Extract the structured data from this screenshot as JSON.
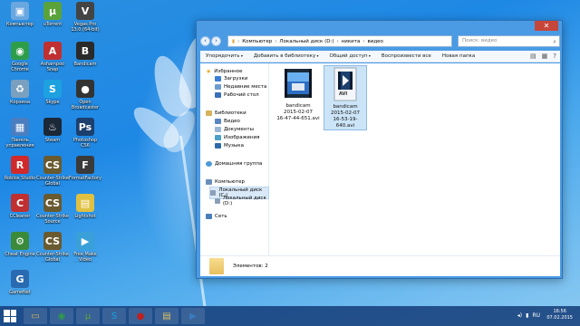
{
  "desktop": {
    "icons": [
      {
        "label": "Компьютер",
        "glyph": "▣",
        "color": "#6aa7e0"
      },
      {
        "label": "uTorrent",
        "glyph": "µ",
        "color": "#5aa33a"
      },
      {
        "label": "Vegas Pro 13.0 (64-bit)",
        "glyph": "V",
        "color": "#444"
      },
      {
        "label": "Google Chrome",
        "glyph": "◉",
        "color": "#2e9d4a"
      },
      {
        "label": "Ashampoo Snap",
        "glyph": "A",
        "color": "#c03030"
      },
      {
        "label": "Bandicam",
        "glyph": "B",
        "color": "#2a2a2a"
      },
      {
        "label": "Корзина",
        "glyph": "♻",
        "color": "#7aa0c0"
      },
      {
        "label": "Skype",
        "glyph": "S",
        "color": "#1da1e0"
      },
      {
        "label": "Open Broadcaster",
        "glyph": "●",
        "color": "#333"
      },
      {
        "label": "Панель управления",
        "glyph": "▦",
        "color": "#4a7ec0"
      },
      {
        "label": "Steam",
        "glyph": "♨",
        "color": "#1b2838"
      },
      {
        "label": "Photoshop CS6",
        "glyph": "Ps",
        "color": "#1c3f6e"
      },
      {
        "label": "Roblox Studio",
        "glyph": "R",
        "color": "#d02a2a"
      },
      {
        "label": "Counter-Strike Global Offensive",
        "glyph": "CS",
        "color": "#6a5a30"
      },
      {
        "label": "FormatFactory",
        "glyph": "F",
        "color": "#3a3a3a"
      },
      {
        "label": "CCleaner",
        "glyph": "C",
        "color": "#c03030"
      },
      {
        "label": "Counter-Strike Source",
        "glyph": "CS",
        "color": "#6a5a30"
      },
      {
        "label": "Lightshot",
        "glyph": "▤",
        "color": "#e0c040"
      },
      {
        "label": "Cheat Engine",
        "glyph": "⚙",
        "color": "#3a8a3a"
      },
      {
        "label": "Counter-Strike Global Offensive",
        "glyph": "CS",
        "color": "#6a5a30"
      },
      {
        "label": "Free Make Video Converter",
        "glyph": "▶",
        "color": "#3aa0d8"
      },
      {
        "label": "GameNet",
        "glyph": "G",
        "color": "#2a6ab0"
      }
    ]
  },
  "window": {
    "close_glyph": "✕",
    "nav": {
      "back": "‹",
      "forward": "›",
      "up": "↑"
    },
    "address": [
      "Компьютер",
      "Локальный диск (D:)",
      "никита",
      "видео"
    ],
    "address_sep": "›",
    "search_placeholder": "Поиск: видео",
    "search_icon": "⌕",
    "toolbar": [
      "Упорядочить",
      "Добавить в библиотеку",
      "Общий доступ",
      "Воспроизвести все",
      "Новая папка"
    ],
    "toolbar_right": [
      "▤",
      "▦",
      "?"
    ],
    "navpane": {
      "favorites": "Избранное",
      "downloads": "Загрузки",
      "recent": "Недавние места",
      "desktop": "Рабочий стол",
      "libraries": "Библиотеки",
      "video": "Видео",
      "documents": "Документы",
      "images": "Изображения",
      "music": "Музыка",
      "homegroup": "Домашняя группа",
      "computer": "Компьютер",
      "disk_c": "Локальный диск (C:)",
      "disk_d": "Локальный диск (D:)",
      "network": "Сеть"
    },
    "files": [
      {
        "line1": "bandicam",
        "line2": "2015-02-07",
        "line3": "16-47-44-651.avi",
        "thumb": "video"
      },
      {
        "line1": "bandicam",
        "line2": "2015-02-07",
        "line3": "16-53-19-640.avi",
        "thumb": "avi",
        "badge": "AVI"
      }
    ],
    "status": "Элементов: 2"
  },
  "taskbar": {
    "apps": [
      {
        "name": "explorer",
        "glyph": "▭",
        "color": "#e0b050"
      },
      {
        "name": "chrome",
        "glyph": "◉",
        "color": "#2e9d4a"
      },
      {
        "name": "utorrent",
        "glyph": "µ",
        "color": "#5aa33a"
      },
      {
        "name": "skype",
        "glyph": "S",
        "color": "#1da1e0"
      },
      {
        "name": "bandicam",
        "glyph": "●",
        "color": "#c02020"
      },
      {
        "name": "folder",
        "glyph": "▤",
        "color": "#e0c060"
      },
      {
        "name": "media",
        "glyph": "▶",
        "color": "#3a7ac0"
      }
    ],
    "lang": "RU",
    "time": "16:56",
    "date": "07.02.2015"
  }
}
